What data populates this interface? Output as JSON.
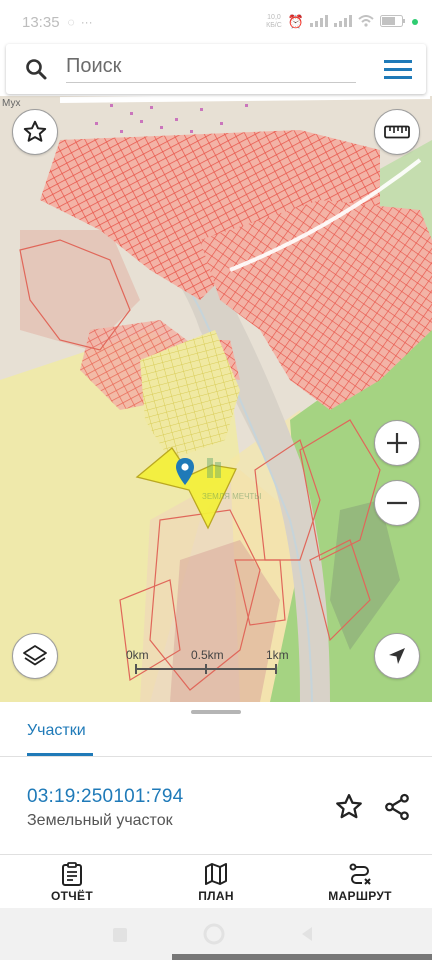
{
  "status_bar": {
    "time": "13:35",
    "extra_icons": [
      "whatsapp-icon",
      "more-dots-icon"
    ],
    "speed_top": "10,0",
    "speed_bottom": "КБ/С",
    "battery": "battery-icon",
    "status_dot_color": "#2ecc71"
  },
  "search": {
    "placeholder": "Поиск",
    "menu_icon": "hamburger-menu-icon"
  },
  "map": {
    "buttons": {
      "favorites": "star-icon",
      "ruler": "ruler-icon",
      "zoom_in": "plus-icon",
      "zoom_out": "minus-icon",
      "layers": "layers-icon",
      "locate": "navigation-arrow-icon"
    },
    "scale": {
      "labels": [
        "0km",
        "0.5km",
        "1km"
      ]
    },
    "watermark": "ЗЕМЛЯ МЕЧТЫ",
    "road_label": "Мух"
  },
  "panel": {
    "tab_label": "Участки",
    "parcel": {
      "id": "03:19:250101:794",
      "type": "Земельный участок"
    }
  },
  "bottom_nav": {
    "items": [
      {
        "label": "ОТЧЁТ",
        "icon": "report-clipboard-icon"
      },
      {
        "label": "ПЛАН",
        "icon": "map-plan-icon"
      },
      {
        "label": "МАРШРУТ",
        "icon": "route-icon"
      }
    ]
  },
  "colors": {
    "accent": "#1f7ab8",
    "parcel_red": "#e8554a",
    "parcel_yellow": "#e8e35a",
    "forest_green": "#a5d382"
  }
}
